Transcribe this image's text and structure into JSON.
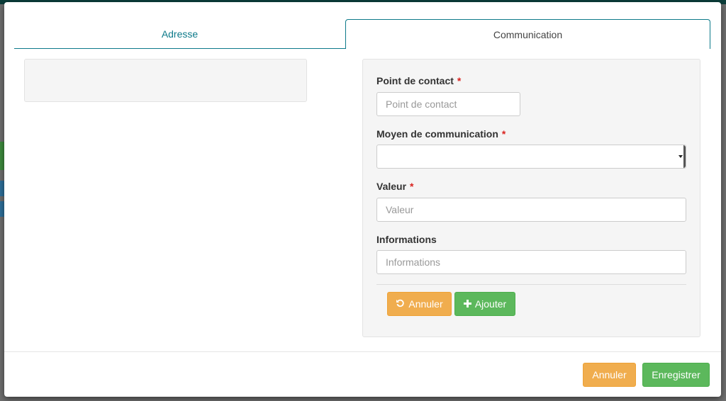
{
  "tabs": [
    {
      "label": "Adresse"
    },
    {
      "label": "Communication"
    }
  ],
  "form": {
    "contact_point": {
      "label": "Point de contact",
      "required_mark": "*",
      "placeholder": "Point de contact",
      "value": ""
    },
    "comm_method": {
      "label": "Moyen de communication",
      "required_mark": "*",
      "selected": ""
    },
    "value": {
      "label": "Valeur",
      "required_mark": "*",
      "placeholder": "Valeur",
      "value": ""
    },
    "info": {
      "label": "Informations",
      "placeholder": "Informations",
      "value": ""
    },
    "cancel_label": "Annuler",
    "add_label": "Ajouter",
    "cancel_icon": "undo-icon",
    "add_icon": "plus-icon"
  },
  "footer": {
    "cancel_label": "Annuler",
    "save_label": "Enregistrer"
  },
  "colors": {
    "tab_accent": "#0d7a8a",
    "warning": "#f0ad4e",
    "success": "#5cb85c",
    "required": "#d9231f"
  }
}
